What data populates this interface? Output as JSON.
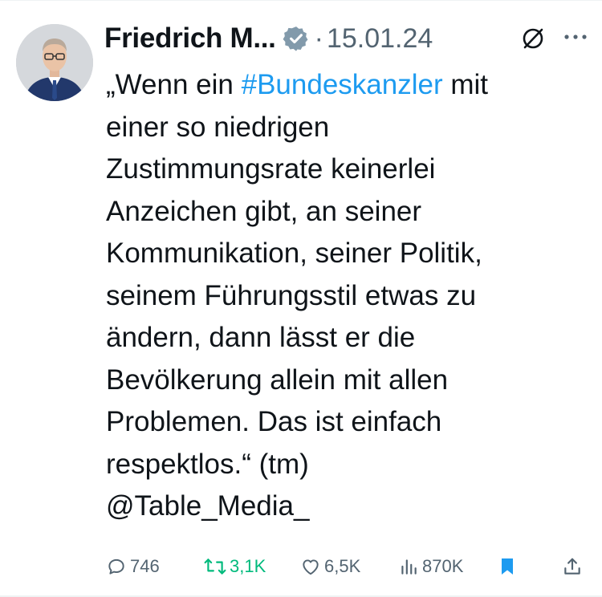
{
  "author": {
    "name": "Friedrich M...",
    "verified_icon": "verified-badge-icon",
    "separator": "·",
    "date": "15.01.24"
  },
  "header_icons": {
    "grok": "grok-slash-icon",
    "more": "more-dots-icon"
  },
  "tweet": {
    "lines": [
      {
        "before": "„Wenn ein ",
        "hashtag": "#Bundeskanzler",
        "after": " mit"
      },
      {
        "text": "einer so niedrigen"
      },
      {
        "text": "Zustimmungsrate keinerlei"
      },
      {
        "text": "Anzeichen gibt, an seiner"
      },
      {
        "text": "Kommunikation, seiner Politik,"
      },
      {
        "text": "seinem Führungsstil etwas zu"
      },
      {
        "text": "ändern, dann lässt er die"
      },
      {
        "text": "Bevölkerung allein mit allen"
      },
      {
        "text": "Problemen. Das ist einfach"
      },
      {
        "text": "respektlos.“ (tm)"
      },
      {
        "text": "@Table_Media_"
      }
    ]
  },
  "actions": {
    "reply": {
      "count": "746",
      "icon": "reply-icon"
    },
    "retweet": {
      "count": "3,1K",
      "icon": "retweet-icon",
      "color": "#00ba7c"
    },
    "like": {
      "count": "6,5K",
      "icon": "heart-icon"
    },
    "views": {
      "count": "870K",
      "icon": "views-icon"
    },
    "bookmark": {
      "icon": "bookmark-icon",
      "color": "#1d9bf0"
    },
    "share": {
      "icon": "share-icon"
    }
  },
  "colors": {
    "text": "#0f1419",
    "muted": "#536471",
    "link": "#1d9bf0",
    "retweet": "#00ba7c",
    "verified": "#829aab"
  }
}
